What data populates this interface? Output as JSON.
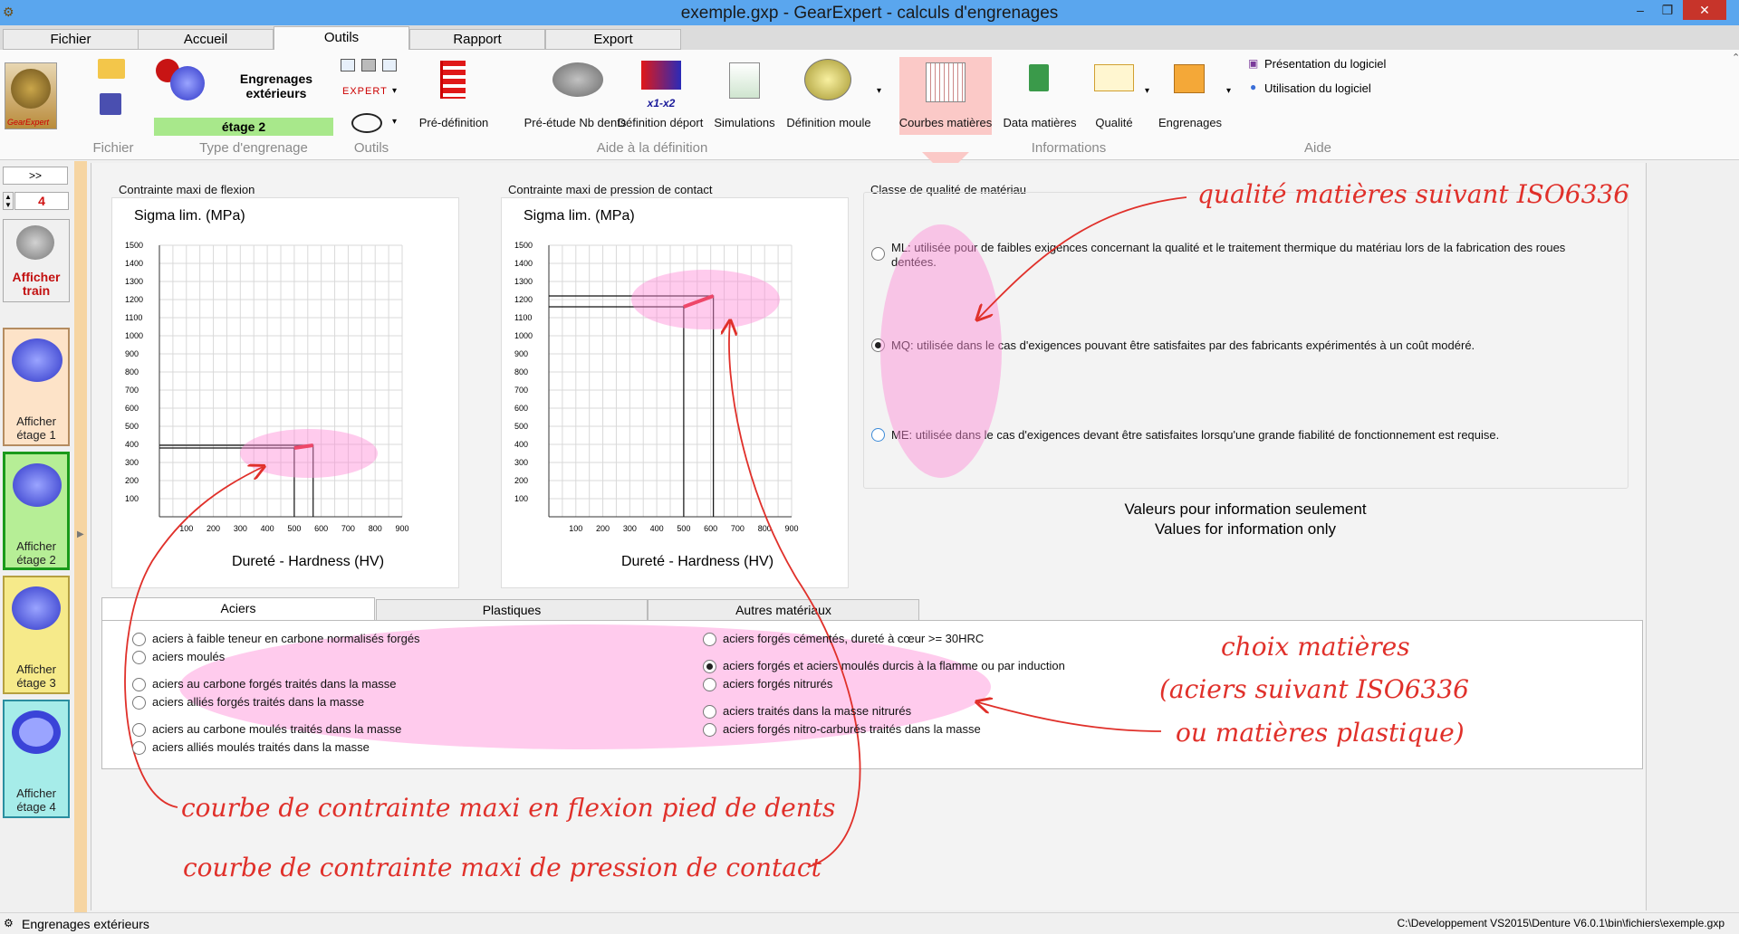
{
  "window": {
    "title": "exemple.gxp - GearExpert - calculs d'engrenages",
    "min": "–",
    "max": "❐",
    "close": "✕"
  },
  "menu_tabs": [
    "Fichier",
    "Accueil",
    "Outils",
    "Rapport",
    "Export"
  ],
  "active_menu_tab": "Outils",
  "ribbon": {
    "logo_text": "GearExpert",
    "gear_type_title": "Engrenages\nextérieurs",
    "stage_label": "étage 2",
    "expert_label": "EXPERT",
    "buttons": {
      "pre_definition": "Pré-définition",
      "pre_etude": "Pré-étude Nb dents",
      "deport": "Définition déport",
      "deport_icon_text": "x1-x2",
      "simulations": "Simulations",
      "moule": "Définition moule",
      "courbes": "Courbes matières",
      "data": "Data matières",
      "qualite": "Qualité",
      "engrenages": "Engrenages"
    },
    "help": {
      "presentation": "Présentation du logiciel",
      "utilisation": "Utilisation du logiciel"
    },
    "groups": {
      "fichier": "Fichier",
      "type": "Type d'engrenage",
      "outils": "Outils",
      "aide_def": "Aide à la définition",
      "informations": "Informations",
      "aide": "Aide"
    }
  },
  "left": {
    "expand": ">>",
    "stage_count": "4",
    "afficher_train": "Afficher\ntrain",
    "stages": [
      "Afficher\nétage 1",
      "Afficher\nétage 2",
      "Afficher\nétage 3",
      "Afficher\nétage 4"
    ],
    "stage_colors": [
      "#fde3c8",
      "#b6ee96",
      "#f6ea8a",
      "#a6ece9"
    ]
  },
  "chart_data": [
    {
      "type": "line",
      "title": "Contrainte maxi de flexion",
      "ylabel": "Sigma lim. (MPa)",
      "xlabel": "Dureté - Hardness (HV)",
      "xticks": [
        100,
        200,
        300,
        400,
        500,
        600,
        700,
        800,
        900
      ],
      "yticks": [
        100,
        200,
        300,
        400,
        500,
        600,
        700,
        800,
        900,
        1000,
        1100,
        1200,
        1300,
        1400,
        1500
      ],
      "xlim": [
        0,
        900
      ],
      "ylim": [
        0,
        1500
      ],
      "grid": true,
      "series": [
        {
          "values": [
            [
              500,
              380
            ],
            [
              570,
              395
            ]
          ],
          "color": "#e01010"
        }
      ],
      "marker_lines": [
        {
          "x": 500,
          "y": 380
        },
        {
          "x": 570,
          "y": 395
        }
      ]
    },
    {
      "type": "line",
      "title": "Contrainte maxi de pression de contact",
      "ylabel": "Sigma lim. (MPa)",
      "xlabel": "Dureté - Hardness (HV)",
      "xticks": [
        100,
        200,
        300,
        400,
        500,
        600,
        700,
        800,
        900
      ],
      "yticks": [
        100,
        200,
        300,
        400,
        500,
        600,
        700,
        800,
        900,
        1000,
        1100,
        1200,
        1300,
        1400,
        1500
      ],
      "xlim": [
        0,
        900
      ],
      "ylim": [
        0,
        1500
      ],
      "grid": true,
      "series": [
        {
          "values": [
            [
              500,
              1160
            ],
            [
              610,
              1220
            ]
          ],
          "color": "#e01010"
        }
      ],
      "marker_lines": [
        {
          "x": 500,
          "y": 1160
        },
        {
          "x": 610,
          "y": 1220
        }
      ]
    }
  ],
  "quality": {
    "title": "Classe de qualité de matériau",
    "options": [
      {
        "text": "ML: utilisée pour de faibles exigences concernant la qualité et le traitement thermique du matériau lors de la fabrication des roues",
        "text2": "dentées.",
        "checked": false
      },
      {
        "text": "MQ: utilisée dans le cas d'exigences pouvant être satisfaites par des fabricants expérimentés à un coût modéré.",
        "checked": true
      },
      {
        "text": "ME: utilisée dans le cas d'exigences devant être satisfaites lorsqu'une grande fiabilité de fonctionnement est requise.",
        "checked": false
      }
    ],
    "info1": "Valeurs pour information seulement",
    "info2": "Values for information only"
  },
  "materials": {
    "tabs": [
      "Aciers",
      "Plastiques",
      "Autres matériaux"
    ],
    "left": [
      {
        "text": "aciers à faible teneur en carbone normalisés forgés",
        "checked": false
      },
      {
        "text": "aciers moulés",
        "checked": false
      },
      {
        "text": "aciers au carbone forgés traités dans la masse",
        "checked": false
      },
      {
        "text": "aciers alliés forgés traités dans la masse",
        "checked": false
      },
      {
        "text": "aciers au carbone moulés traités dans la masse",
        "checked": false
      },
      {
        "text": "aciers alliés moulés traités dans la masse",
        "checked": false
      }
    ],
    "right": [
      {
        "text": "aciers forgés cémentés, dureté à cœur >= 30HRC",
        "checked": false
      },
      {
        "text": "aciers forgés et aciers moulés durcis à la flamme ou par induction",
        "checked": true
      },
      {
        "text": "aciers forgés nitrurés",
        "checked": false
      },
      {
        "text": "aciers traités dans la masse nitrurés",
        "checked": false
      },
      {
        "text": "aciers forgés nitro-carburés traités dans la masse",
        "checked": false
      }
    ]
  },
  "annotations": {
    "qualite": "qualité matières suivant ISO6336",
    "choix1": "choix matières",
    "choix2": "(aciers suivant ISO6336",
    "choix3": "ou matières plastique)",
    "flexion": "courbe de contrainte maxi en flexion pied de dents",
    "contact": "courbe de contrainte maxi de pression de contact"
  },
  "status": {
    "left": "Engrenages extérieurs",
    "right": "C:\\Developpement VS2015\\Denture V6.0.1\\bin\\fichiers\\exemple.gxp"
  }
}
